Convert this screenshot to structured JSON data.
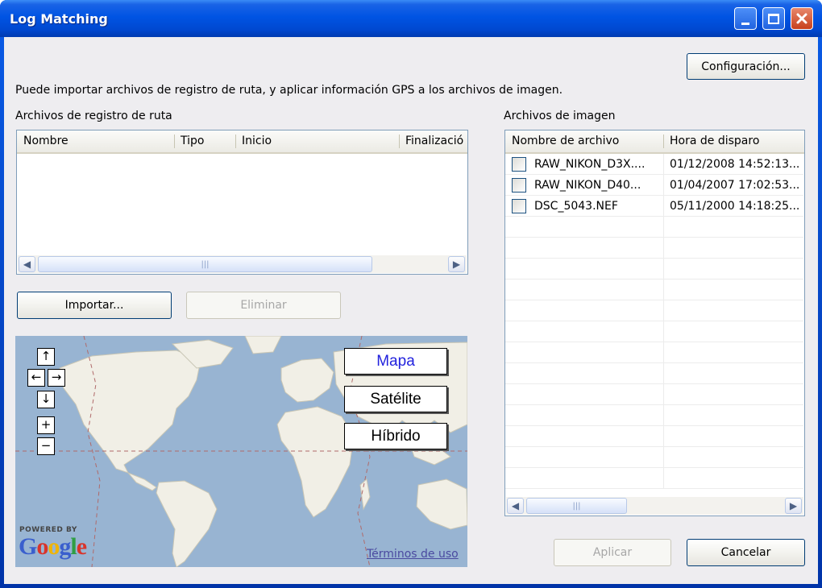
{
  "window": {
    "title": "Log Matching"
  },
  "description": "Puede importar archivos de registro de ruta, y aplicar información GPS a los archivos de imagen.",
  "buttons": {
    "config": "Configuración...",
    "import": "Importar...",
    "delete": "Eliminar",
    "apply": "Aplicar",
    "cancel": "Cancelar"
  },
  "logs": {
    "label": "Archivos de registro de ruta",
    "columns": [
      "Nombre",
      "Tipo",
      "Inicio",
      "Finalizació"
    ],
    "rows": []
  },
  "images": {
    "label": "Archivos de imagen",
    "columns": [
      "Nombre de archivo",
      "Hora de disparo"
    ],
    "rows": [
      {
        "name": "RAW_NIKON_D3X....",
        "time": "01/12/2008 14:52:13...",
        "checked": false
      },
      {
        "name": "RAW_NIKON_D40...",
        "time": "01/04/2007 17:02:53...",
        "checked": false
      },
      {
        "name": "DSC_5043.NEF",
        "time": "05/11/2000 14:18:25...",
        "checked": false
      }
    ]
  },
  "map": {
    "types": [
      "Mapa",
      "Satélite",
      "Híbrido"
    ],
    "selected_type": "Mapa",
    "selected_color": "#2222dd",
    "powered_by": "POWERED BY",
    "brand": "Google",
    "terms": "Términos de uso"
  },
  "scrollbar": {
    "grip": "|||"
  }
}
